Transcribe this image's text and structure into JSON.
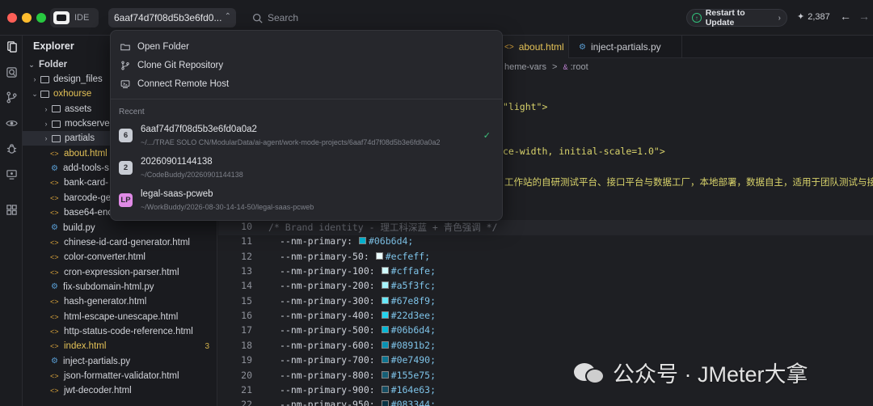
{
  "titlebar": {
    "ide_label": "IDE",
    "project": "6aaf74d7f08d5b3e6fd0...",
    "search_placeholder": "Search",
    "restart_label": "Restart to Update",
    "stars": "2,387"
  },
  "explorer": {
    "title": "Explorer",
    "root": "Folder",
    "items": [
      {
        "label": "design_files",
        "kind": "folder",
        "open": false,
        "depth": 1
      },
      {
        "label": "oxhourse",
        "kind": "folder",
        "open": true,
        "depth": 1,
        "highlight": true
      },
      {
        "label": "assets",
        "kind": "folder",
        "open": false,
        "depth": 2
      },
      {
        "label": "mockserver",
        "kind": "folder",
        "open": false,
        "depth": 2
      },
      {
        "label": "partials",
        "kind": "folder",
        "open": false,
        "depth": 2,
        "selected": true
      },
      {
        "label": "about.html",
        "kind": "html",
        "depth": 2,
        "highlight": true
      },
      {
        "label": "add-tools-s",
        "kind": "py",
        "depth": 2
      },
      {
        "label": "bank-card-",
        "kind": "html",
        "depth": 2
      },
      {
        "label": "barcode-ge",
        "kind": "html",
        "depth": 2
      },
      {
        "label": "base64-enc",
        "kind": "html",
        "depth": 2
      },
      {
        "label": "build.py",
        "kind": "py",
        "depth": 2
      },
      {
        "label": "chinese-id-card-generator.html",
        "kind": "html",
        "depth": 2
      },
      {
        "label": "color-converter.html",
        "kind": "html",
        "depth": 2
      },
      {
        "label": "cron-expression-parser.html",
        "kind": "html",
        "depth": 2
      },
      {
        "label": "fix-subdomain-html.py",
        "kind": "py",
        "depth": 2
      },
      {
        "label": "hash-generator.html",
        "kind": "html",
        "depth": 2
      },
      {
        "label": "html-escape-unescape.html",
        "kind": "html",
        "depth": 2
      },
      {
        "label": "http-status-code-reference.html",
        "kind": "html",
        "depth": 2
      },
      {
        "label": "index.html",
        "kind": "html",
        "depth": 2,
        "highlight": true,
        "badge": "3"
      },
      {
        "label": "inject-partials.py",
        "kind": "py",
        "depth": 2
      },
      {
        "label": "json-formatter-validator.html",
        "kind": "html",
        "depth": 2
      },
      {
        "label": "jwt-decoder.html",
        "kind": "html",
        "depth": 2
      }
    ]
  },
  "tabs": [
    {
      "label": "about.html",
      "kind": "html",
      "active": true
    },
    {
      "label": "inject-partials.py",
      "kind": "py",
      "active": false
    }
  ],
  "breadcrumb": {
    "part1": "heme-vars",
    "sep": ">",
    "part2": ":root"
  },
  "code_top": [
    {
      "text": "\"light\">"
    },
    {
      "text": "ce-width, initial-scale=1.0\">"
    },
    {
      "text": "工作站的自研测试平台、接口平台与数据工厂，本地部署，数据自主，适用于团队测试与接口管"
    }
  ],
  "code_lines": [
    {
      "n": "10",
      "prop": "",
      "val": "",
      "comment": "/* Brand identity - 理工科深蓝 + 青色强调 */",
      "color": ""
    },
    {
      "n": "11",
      "prop": "--nm-primary:",
      "val": "#06b6d4;",
      "comment": "",
      "color": "#06b6d4"
    },
    {
      "n": "12",
      "prop": "--nm-primary-50:",
      "val": "#ecfeff;",
      "comment": "",
      "color": "#ecfeff"
    },
    {
      "n": "13",
      "prop": "--nm-primary-100:",
      "val": "#cffafe;",
      "comment": "",
      "color": "#cffafe"
    },
    {
      "n": "14",
      "prop": "--nm-primary-200:",
      "val": "#a5f3fc;",
      "comment": "",
      "color": "#a5f3fc"
    },
    {
      "n": "15",
      "prop": "--nm-primary-300:",
      "val": "#67e8f9;",
      "comment": "",
      "color": "#67e8f9"
    },
    {
      "n": "16",
      "prop": "--nm-primary-400:",
      "val": "#22d3ee;",
      "comment": "",
      "color": "#22d3ee"
    },
    {
      "n": "17",
      "prop": "--nm-primary-500:",
      "val": "#06b6d4;",
      "comment": "",
      "color": "#06b6d4"
    },
    {
      "n": "18",
      "prop": "--nm-primary-600:",
      "val": "#0891b2;",
      "comment": "",
      "color": "#0891b2"
    },
    {
      "n": "19",
      "prop": "--nm-primary-700:",
      "val": "#0e7490;",
      "comment": "",
      "color": "#0e7490"
    },
    {
      "n": "20",
      "prop": "--nm-primary-800:",
      "val": "#155e75;",
      "comment": "",
      "color": "#155e75"
    },
    {
      "n": "21",
      "prop": "--nm-primary-900:",
      "val": "#164e63;",
      "comment": "",
      "color": "#164e63"
    },
    {
      "n": "22",
      "prop": "--nm-primary-950:",
      "val": "#083344;",
      "comment": "",
      "color": "#083344"
    }
  ],
  "popup": {
    "actions": [
      {
        "label": "Open Folder",
        "icon": "folder-open-icon"
      },
      {
        "label": "Clone Git Repository",
        "icon": "git-branch-icon"
      },
      {
        "label": "Connect Remote Host",
        "icon": "remote-host-icon"
      }
    ],
    "recent_heading": "Recent",
    "recent": [
      {
        "avatar": "6",
        "name": "6aaf74d7f08d5b3e6fd0a0a2",
        "path": "~/.../TRAE SOLO CN/ModularData/ai-agent/work-mode-projects/6aaf74d7f08d5b3e6fd0a0a2",
        "checked": true,
        "color": "#c8ccd4"
      },
      {
        "avatar": "2",
        "name": "20260901144138",
        "path": "~/CodeBuddy/20260901144138",
        "checked": false,
        "color": "#c8ccd4"
      },
      {
        "avatar": "LP",
        "name": "legal-saas-pcweb",
        "path": "~/WorkBuddy/2026-08-30-14-14-50/legal-saas-pcweb",
        "checked": false,
        "color": "#e08ae6"
      }
    ]
  },
  "watermark": {
    "text": "公众号 · JMeter大拿"
  },
  "colors": {
    "accent": "#e4c257",
    "check": "#3ec27d",
    "bg": "#1e1f23"
  }
}
